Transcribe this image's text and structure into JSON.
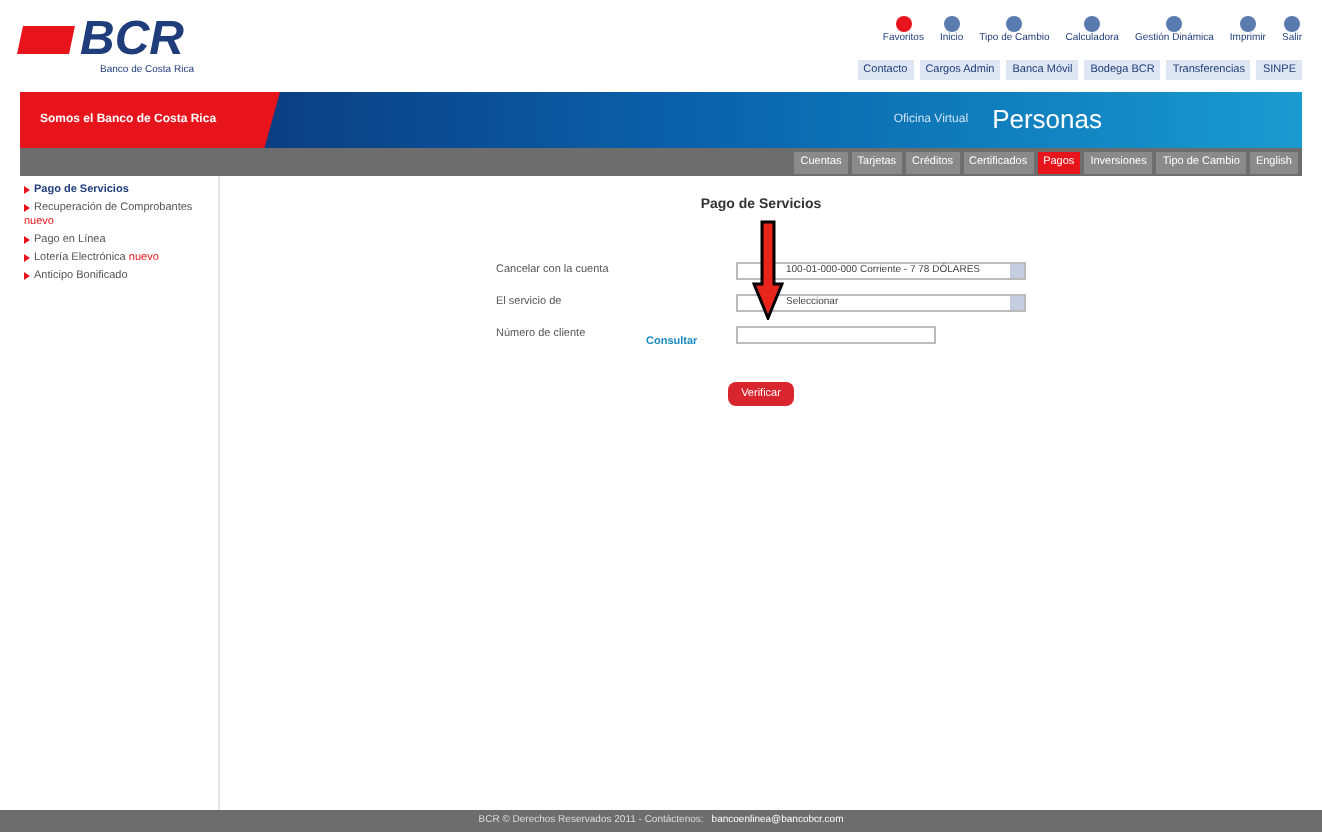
{
  "header": {
    "logo": "BCR",
    "logo_subtitle": "Banco de Costa Rica",
    "tools": [
      {
        "label": "Favoritos"
      },
      {
        "label": "Inicio"
      },
      {
        "label": "Tipo de Cambio"
      },
      {
        "label": "Calculadora"
      },
      {
        "label": "Gestión Dinámica"
      },
      {
        "label": "Imprimir"
      },
      {
        "label": "Salir"
      }
    ],
    "links": [
      "Contacto",
      "Cargos Admin",
      "Banca Móvil",
      "Bodega BCR",
      "Transferencias",
      "SINPE"
    ]
  },
  "banner": {
    "slogan": "Somos el Banco de Costa Rica",
    "section": "Oficina Virtual",
    "title": "Personas"
  },
  "nav": [
    {
      "label": "Cuentas",
      "selected": false
    },
    {
      "label": "Tarjetas",
      "selected": false
    },
    {
      "label": "Créditos",
      "selected": false
    },
    {
      "label": "Certificados",
      "selected": false
    },
    {
      "label": "Pagos",
      "selected": true
    },
    {
      "label": "Inversiones",
      "selected": false
    },
    {
      "label": "Tipo de Cambio",
      "selected": false
    },
    {
      "label": "English",
      "selected": false
    }
  ],
  "sidebar": {
    "items": [
      {
        "label": "Pago de Servicios",
        "selected": true
      },
      {
        "label": "Recuperación de Comprobantes",
        "badge": "nuevo",
        "selected": false
      },
      {
        "label": "Pago en Línea",
        "selected": false
      },
      {
        "label": "Lotería Electrónica",
        "badge": "nuevo",
        "selected": false
      },
      {
        "label": "Anticipo Bonificado",
        "selected": false
      }
    ]
  },
  "form": {
    "title": "Pago de Servicios",
    "fields": [
      {
        "kind": "select",
        "label": "Cancelar con la cuenta",
        "value": "100-01-000-000 Corriente - 7 78 DÓLARES"
      },
      {
        "kind": "select",
        "label": "El servicio de",
        "value": "Seleccionar"
      },
      {
        "kind": "text",
        "label": "Número de cliente",
        "link": "Consultar"
      }
    ],
    "button": "Verificar"
  },
  "footer": {
    "text": "BCR © Derechos Reservados 2011 - Contáctenos:",
    "email": "bancoenlinea@bancobcr.com"
  }
}
